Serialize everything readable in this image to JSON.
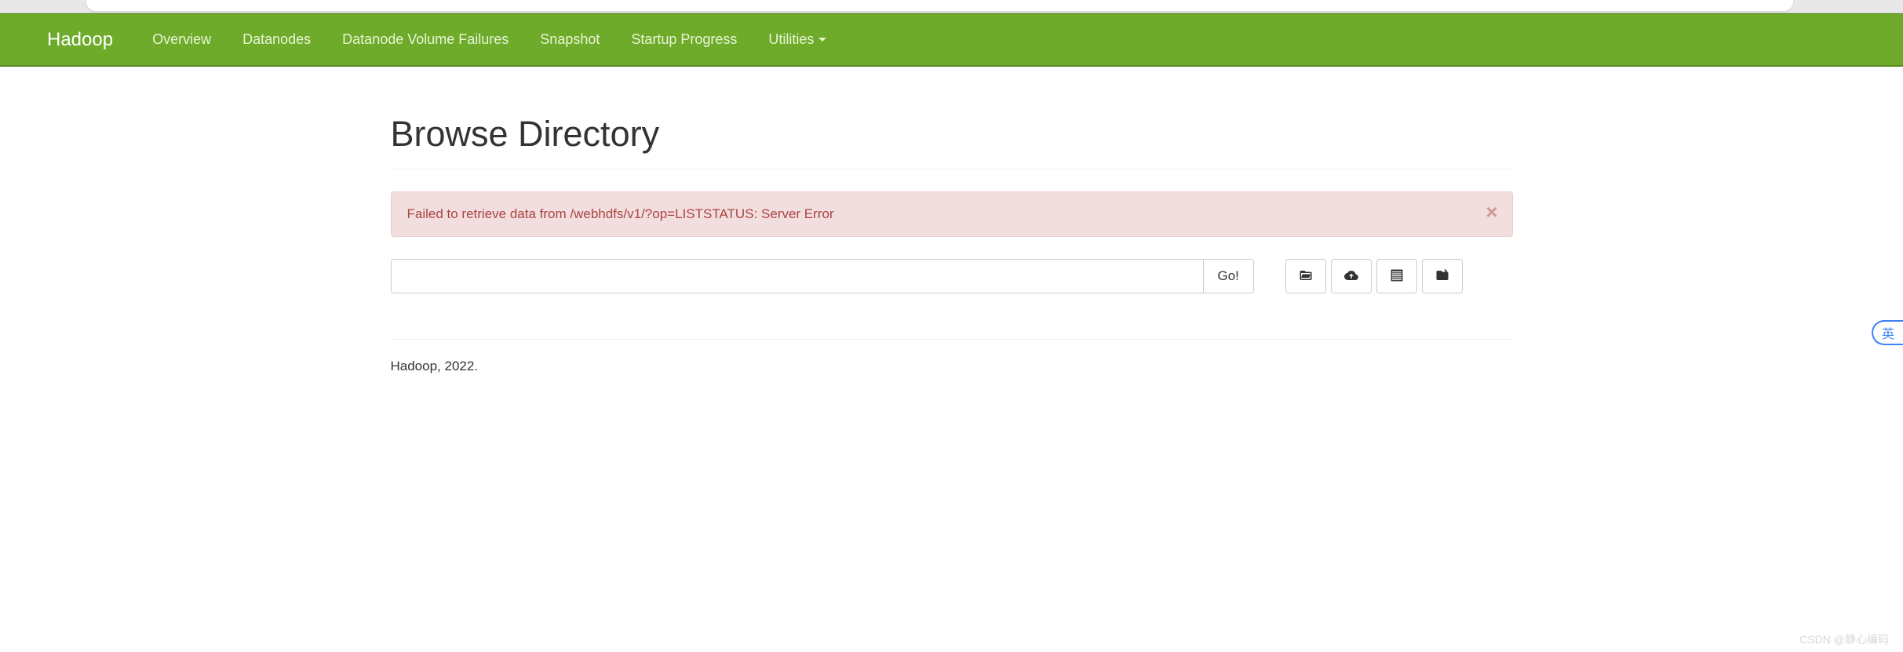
{
  "brand": "Hadoop",
  "nav": {
    "overview": "Overview",
    "datanodes": "Datanodes",
    "dvf": "Datanode Volume Failures",
    "snapshot": "Snapshot",
    "startup": "Startup Progress",
    "utilities": "Utilities"
  },
  "page_title": "Browse Directory",
  "alert_message": "Failed to retrieve data from /webhdfs/v1/?op=LISTSTATUS: Server Error",
  "path_value": "",
  "go_label": "Go!",
  "footer_text": "Hadoop, 2022.",
  "lang_bubble": "英",
  "watermark": "CSDN @静心编码"
}
